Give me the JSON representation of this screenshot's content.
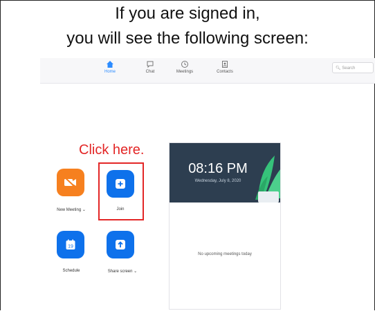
{
  "headline": {
    "line1": "If you are signed in,",
    "line2": "you will see the following screen:"
  },
  "nav": {
    "items": [
      {
        "label": "Home",
        "icon": "home-icon",
        "active": true
      },
      {
        "label": "Chat",
        "icon": "chat-icon",
        "active": false
      },
      {
        "label": "Meetings",
        "icon": "clock-icon",
        "active": false
      },
      {
        "label": "Contacts",
        "icon": "contacts-icon",
        "active": false
      }
    ],
    "search_placeholder": "Search"
  },
  "actions": {
    "new_meeting": "New Meeting",
    "join": "Join",
    "schedule": "Schedule",
    "share_screen": "Share screen",
    "calendar_day": "19"
  },
  "annotation": "Click here.",
  "card": {
    "time": "08:16 PM",
    "date": "Wednesday, July 8, 2020",
    "empty_text": "No upcoming meetings today"
  },
  "colors": {
    "accent": "#0e71eb",
    "new_meeting": "#f6801f",
    "annotation": "#e32626",
    "card_header": "#2d3e50"
  }
}
